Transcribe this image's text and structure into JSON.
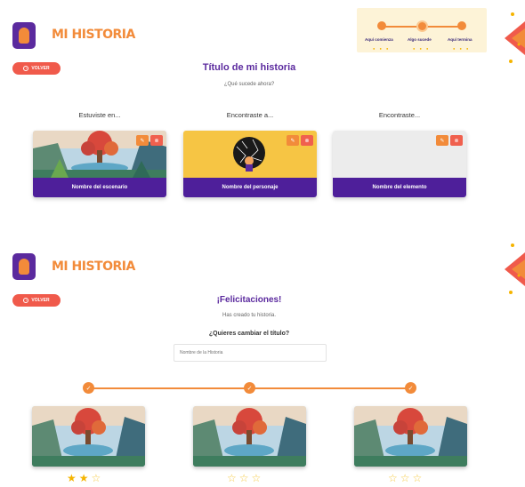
{
  "brand": {
    "name": "MI HISTORIA"
  },
  "screen1": {
    "back_label": "VOLVER",
    "title": "Título de mi historia",
    "subtitle": "¿Qué sucede ahora?",
    "progress": {
      "steps": [
        {
          "label": "Aquí comienza"
        },
        {
          "label": "Algo sucede"
        },
        {
          "label": "Aquí termina"
        }
      ]
    },
    "columns": [
      {
        "label": "Estuviste en...",
        "card_label": "Nombre del escenario"
      },
      {
        "label": "Encontraste a...",
        "card_label": "Nombre del personaje"
      },
      {
        "label": "Encontraste...",
        "card_label": "Nombre del elemento"
      }
    ]
  },
  "screen2": {
    "back_label": "VOLVER",
    "title": "¡Felicitaciones!",
    "subtitle": "Has creado tu historia.",
    "question": "¿Quieres cambiar el título?",
    "input_placeholder": "Nombre de la Historia",
    "stories": [
      {
        "rating": 2,
        "max": 3
      },
      {
        "rating": 0,
        "max": 3
      },
      {
        "rating": 0,
        "max": 3
      }
    ]
  },
  "colors": {
    "brand_purple": "#5b2a9e",
    "accent_orange": "#f28b3a",
    "back_red": "#f05a4b",
    "star_yellow": "#f5b400"
  }
}
